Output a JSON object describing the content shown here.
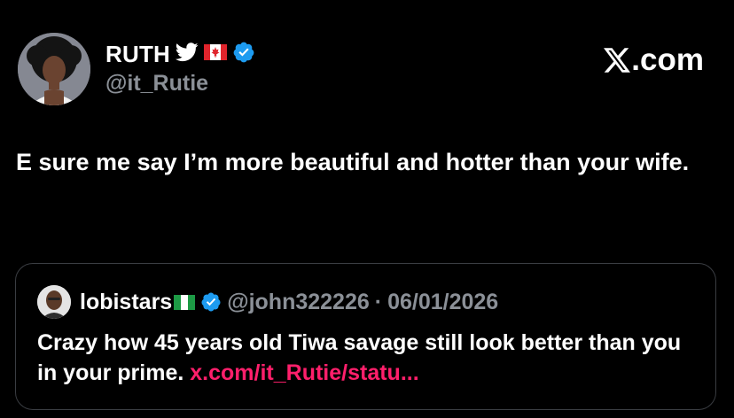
{
  "author": {
    "display_name": "RUTH",
    "handle": "@it_Rutie",
    "bird_icon": "twitter-bird-icon",
    "flag_icon": "canada-flag-icon",
    "verified_icon": "verified-badge-icon"
  },
  "brand": {
    "label": ".com",
    "logo_icon": "x-logo-icon"
  },
  "tweet": {
    "text": "E sure me say I’m more beautiful and hotter than your wife."
  },
  "quote": {
    "display_name": "lobistars",
    "flag_icon": "nigeria-flag-icon",
    "verified_icon": "verified-badge-icon",
    "handle": "@john322226",
    "separator": "·",
    "date": "06/01/2026",
    "text": "Crazy how 45 years old Tiwa savage still look better than you in your prime.",
    "link": "x.com/it_Rutie/statu..."
  },
  "colors": {
    "background": "#000000",
    "text_primary": "#ffffff",
    "text_secondary": "#8b9097",
    "verified_blue": "#1d9bf0",
    "link_pink": "#ff1f6b",
    "card_border": "#3a3d42"
  }
}
